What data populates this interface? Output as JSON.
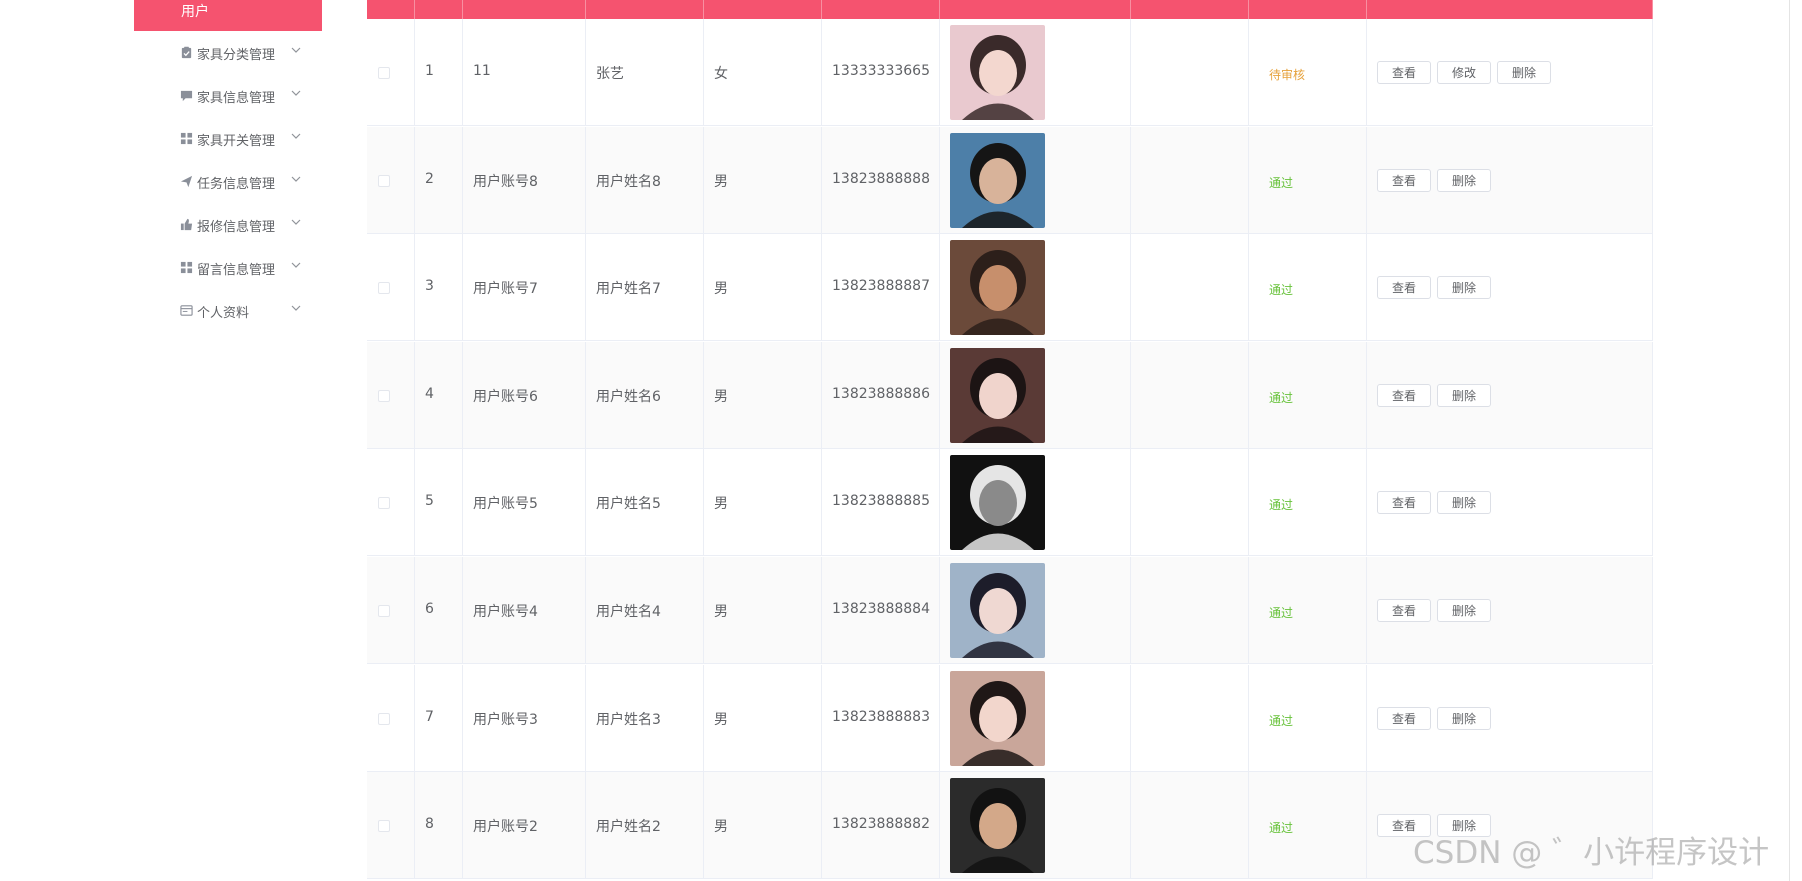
{
  "sidebar": {
    "active_item": "用户",
    "items": [
      {
        "label": "家具分类管理",
        "icon": "clipboard-icon"
      },
      {
        "label": "家具信息管理",
        "icon": "message-icon"
      },
      {
        "label": "家具开关管理",
        "icon": "grid-icon"
      },
      {
        "label": "任务信息管理",
        "icon": "send-icon"
      },
      {
        "label": "报修信息管理",
        "icon": "thumb-icon"
      },
      {
        "label": "留言信息管理",
        "icon": "grid-icon"
      },
      {
        "label": "个人资料",
        "icon": "card-icon"
      }
    ]
  },
  "colors": {
    "primary": "#f5536f",
    "status_pending": "#e6a23c",
    "status_passed": "#67c23a"
  },
  "table": {
    "rows": [
      {
        "index": "1",
        "account": "11",
        "name": "张艺",
        "gender": "女",
        "phone": "13333333665",
        "status": "待审核",
        "status_type": "pending",
        "actions": [
          "查看",
          "修改",
          "删除"
        ],
        "avatar": "avatar-photo-icon"
      },
      {
        "index": "2",
        "account": "用户账号8",
        "name": "用户姓名8",
        "gender": "男",
        "phone": "13823888888",
        "status": "通过",
        "status_type": "passed",
        "actions": [
          "查看",
          "删除"
        ],
        "avatar": "avatar-photo-icon"
      },
      {
        "index": "3",
        "account": "用户账号7",
        "name": "用户姓名7",
        "gender": "男",
        "phone": "13823888887",
        "status": "通过",
        "status_type": "passed",
        "actions": [
          "查看",
          "删除"
        ],
        "avatar": "avatar-photo-icon"
      },
      {
        "index": "4",
        "account": "用户账号6",
        "name": "用户姓名6",
        "gender": "男",
        "phone": "13823888886",
        "status": "通过",
        "status_type": "passed",
        "actions": [
          "查看",
          "删除"
        ],
        "avatar": "avatar-photo-icon"
      },
      {
        "index": "5",
        "account": "用户账号5",
        "name": "用户姓名5",
        "gender": "男",
        "phone": "13823888885",
        "status": "通过",
        "status_type": "passed",
        "actions": [
          "查看",
          "删除"
        ],
        "avatar": "avatar-photo-icon"
      },
      {
        "index": "6",
        "account": "用户账号4",
        "name": "用户姓名4",
        "gender": "男",
        "phone": "13823888884",
        "status": "通过",
        "status_type": "passed",
        "actions": [
          "查看",
          "删除"
        ],
        "avatar": "avatar-photo-icon"
      },
      {
        "index": "7",
        "account": "用户账号3",
        "name": "用户姓名3",
        "gender": "男",
        "phone": "13823888883",
        "status": "通过",
        "status_type": "passed",
        "actions": [
          "查看",
          "删除"
        ],
        "avatar": "avatar-photo-icon"
      },
      {
        "index": "8",
        "account": "用户账号2",
        "name": "用户姓名2",
        "gender": "男",
        "phone": "13823888882",
        "status": "通过",
        "status_type": "passed",
        "actions": [
          "查看",
          "删除"
        ],
        "avatar": "avatar-photo-icon"
      }
    ]
  },
  "watermark": "CSDN @ ゛小许程序设计"
}
